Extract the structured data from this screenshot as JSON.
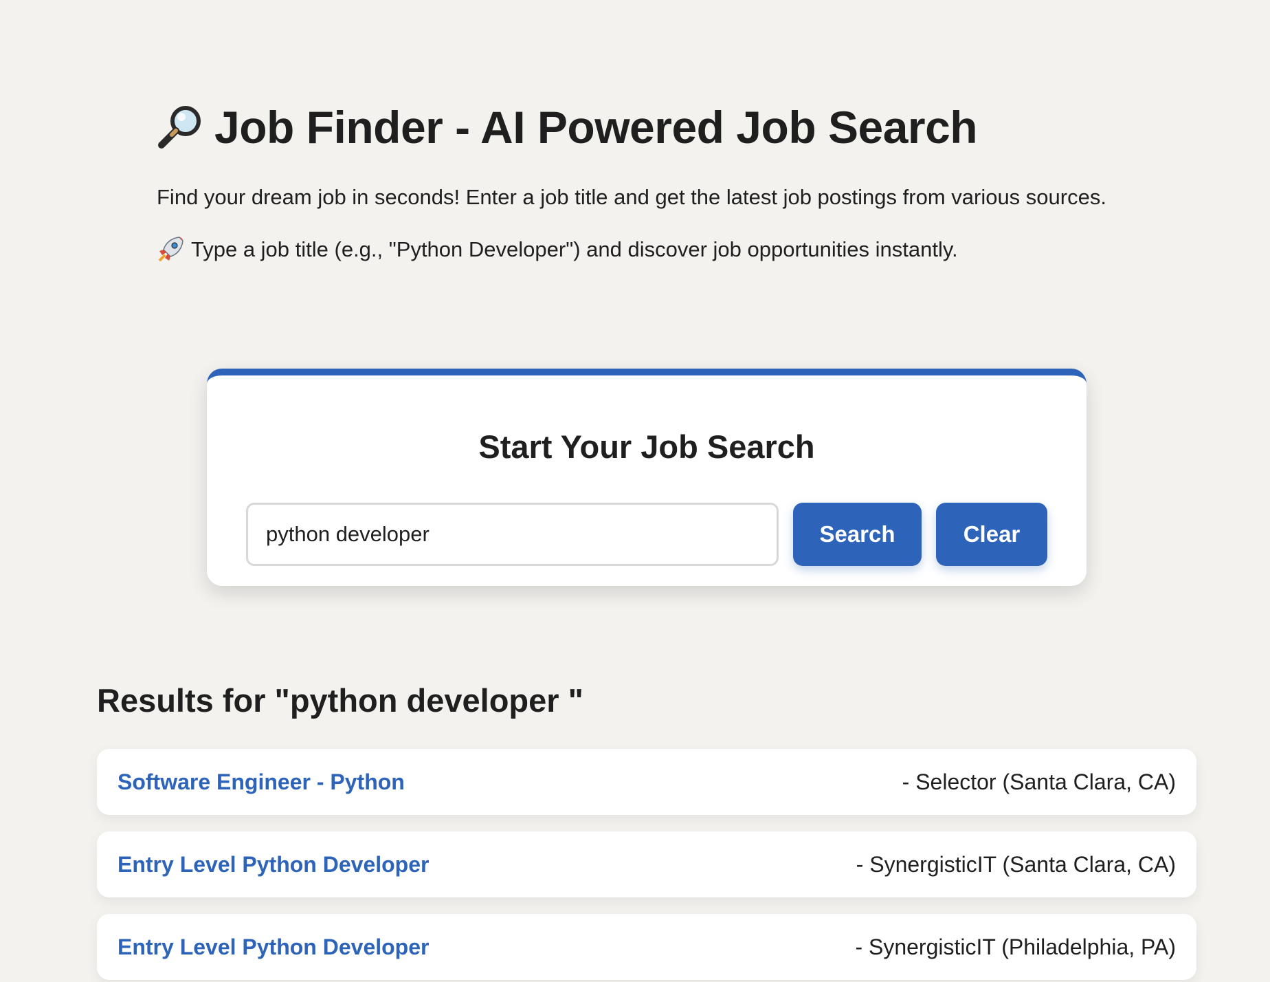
{
  "header": {
    "title": "Job Finder - AI Powered Job Search",
    "title_icon": "magnifier-icon",
    "intro": "Find your dream job in seconds! Enter a job title and get the latest job postings from various sources.",
    "hint_icon": "rocket-icon",
    "hint": "Type a job title (e.g., \"Python Developer\") and discover job opportunities instantly."
  },
  "search": {
    "heading": "Start Your Job Search",
    "input_value": "python developer",
    "search_label": "Search",
    "clear_label": "Clear",
    "accent_color": "#2d63b8"
  },
  "results": {
    "title": "Results for \"python developer \"",
    "items": [
      {
        "title": "Software Engineer - Python",
        "meta": "- Selector (Santa Clara, CA)"
      },
      {
        "title": "Entry Level Python Developer",
        "meta": "- SynergisticIT (Santa Clara, CA)"
      },
      {
        "title": "Entry Level Python Developer",
        "meta": "- SynergisticIT (Philadelphia, PA)"
      }
    ]
  }
}
